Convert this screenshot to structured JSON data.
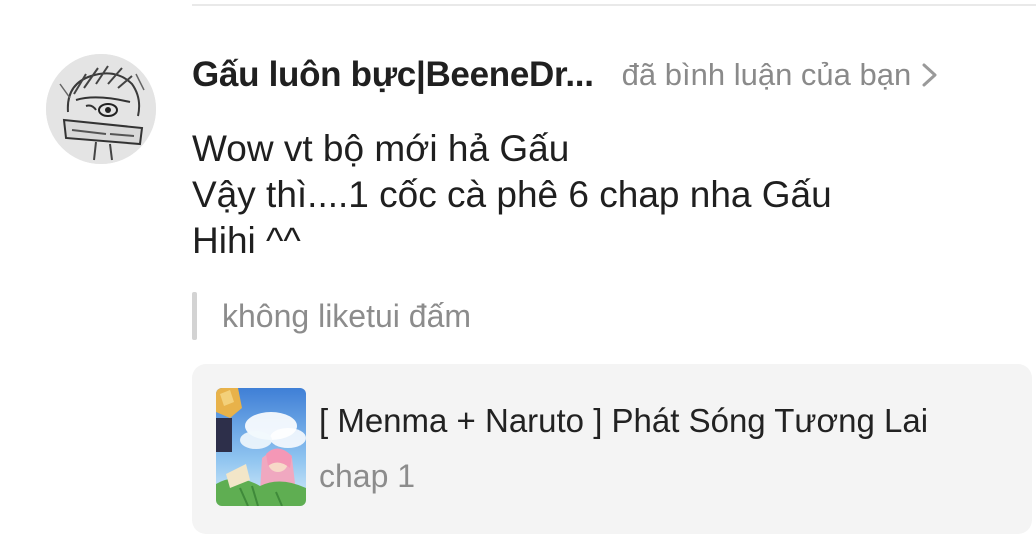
{
  "notification": {
    "username": "Gấu luôn bực|BeeneDr...",
    "action": "đã bình luận của bạn",
    "comment_lines": [
      "Wow vt bộ mới hả Gấu",
      "Vậy thì....1 cốc cà phê 6 chap nha Gấu",
      "Hihi ^^"
    ],
    "quoted_comment": "không liketui đấm"
  },
  "story": {
    "title": "[ Menma + Naruto ] Phát Sóng Tương Lai",
    "chapter": "chap 1"
  },
  "icons": {
    "avatar": "sketch-avatar-icon",
    "chevron": "chevron-right-icon",
    "cover": "story-cover-image"
  },
  "colors": {
    "primary_text": "#1f1f1f",
    "secondary_text": "#8a8a8a",
    "card_background": "#f4f4f4",
    "quote_bar": "#d3d3d3"
  }
}
